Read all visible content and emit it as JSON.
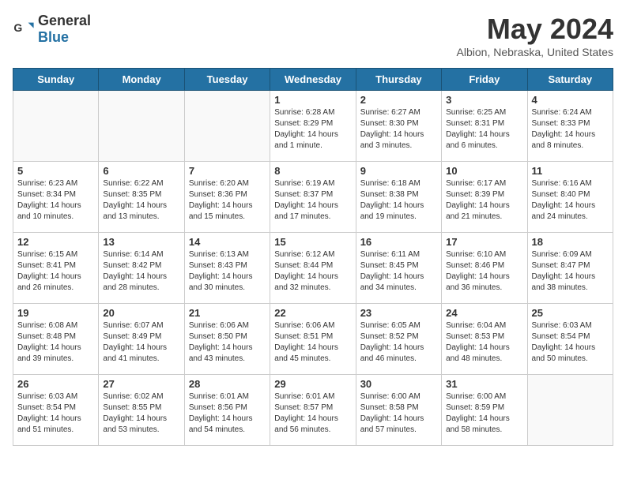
{
  "header": {
    "logo_general": "General",
    "logo_blue": "Blue",
    "month_title": "May 2024",
    "location": "Albion, Nebraska, United States"
  },
  "days_of_week": [
    "Sunday",
    "Monday",
    "Tuesday",
    "Wednesday",
    "Thursday",
    "Friday",
    "Saturday"
  ],
  "weeks": [
    [
      {
        "day": "",
        "info": ""
      },
      {
        "day": "",
        "info": ""
      },
      {
        "day": "",
        "info": ""
      },
      {
        "day": "1",
        "info": "Sunrise: 6:28 AM\nSunset: 8:29 PM\nDaylight: 14 hours\nand 1 minute."
      },
      {
        "day": "2",
        "info": "Sunrise: 6:27 AM\nSunset: 8:30 PM\nDaylight: 14 hours\nand 3 minutes."
      },
      {
        "day": "3",
        "info": "Sunrise: 6:25 AM\nSunset: 8:31 PM\nDaylight: 14 hours\nand 6 minutes."
      },
      {
        "day": "4",
        "info": "Sunrise: 6:24 AM\nSunset: 8:33 PM\nDaylight: 14 hours\nand 8 minutes."
      }
    ],
    [
      {
        "day": "5",
        "info": "Sunrise: 6:23 AM\nSunset: 8:34 PM\nDaylight: 14 hours\nand 10 minutes."
      },
      {
        "day": "6",
        "info": "Sunrise: 6:22 AM\nSunset: 8:35 PM\nDaylight: 14 hours\nand 13 minutes."
      },
      {
        "day": "7",
        "info": "Sunrise: 6:20 AM\nSunset: 8:36 PM\nDaylight: 14 hours\nand 15 minutes."
      },
      {
        "day": "8",
        "info": "Sunrise: 6:19 AM\nSunset: 8:37 PM\nDaylight: 14 hours\nand 17 minutes."
      },
      {
        "day": "9",
        "info": "Sunrise: 6:18 AM\nSunset: 8:38 PM\nDaylight: 14 hours\nand 19 minutes."
      },
      {
        "day": "10",
        "info": "Sunrise: 6:17 AM\nSunset: 8:39 PM\nDaylight: 14 hours\nand 21 minutes."
      },
      {
        "day": "11",
        "info": "Sunrise: 6:16 AM\nSunset: 8:40 PM\nDaylight: 14 hours\nand 24 minutes."
      }
    ],
    [
      {
        "day": "12",
        "info": "Sunrise: 6:15 AM\nSunset: 8:41 PM\nDaylight: 14 hours\nand 26 minutes."
      },
      {
        "day": "13",
        "info": "Sunrise: 6:14 AM\nSunset: 8:42 PM\nDaylight: 14 hours\nand 28 minutes."
      },
      {
        "day": "14",
        "info": "Sunrise: 6:13 AM\nSunset: 8:43 PM\nDaylight: 14 hours\nand 30 minutes."
      },
      {
        "day": "15",
        "info": "Sunrise: 6:12 AM\nSunset: 8:44 PM\nDaylight: 14 hours\nand 32 minutes."
      },
      {
        "day": "16",
        "info": "Sunrise: 6:11 AM\nSunset: 8:45 PM\nDaylight: 14 hours\nand 34 minutes."
      },
      {
        "day": "17",
        "info": "Sunrise: 6:10 AM\nSunset: 8:46 PM\nDaylight: 14 hours\nand 36 minutes."
      },
      {
        "day": "18",
        "info": "Sunrise: 6:09 AM\nSunset: 8:47 PM\nDaylight: 14 hours\nand 38 minutes."
      }
    ],
    [
      {
        "day": "19",
        "info": "Sunrise: 6:08 AM\nSunset: 8:48 PM\nDaylight: 14 hours\nand 39 minutes."
      },
      {
        "day": "20",
        "info": "Sunrise: 6:07 AM\nSunset: 8:49 PM\nDaylight: 14 hours\nand 41 minutes."
      },
      {
        "day": "21",
        "info": "Sunrise: 6:06 AM\nSunset: 8:50 PM\nDaylight: 14 hours\nand 43 minutes."
      },
      {
        "day": "22",
        "info": "Sunrise: 6:06 AM\nSunset: 8:51 PM\nDaylight: 14 hours\nand 45 minutes."
      },
      {
        "day": "23",
        "info": "Sunrise: 6:05 AM\nSunset: 8:52 PM\nDaylight: 14 hours\nand 46 minutes."
      },
      {
        "day": "24",
        "info": "Sunrise: 6:04 AM\nSunset: 8:53 PM\nDaylight: 14 hours\nand 48 minutes."
      },
      {
        "day": "25",
        "info": "Sunrise: 6:03 AM\nSunset: 8:54 PM\nDaylight: 14 hours\nand 50 minutes."
      }
    ],
    [
      {
        "day": "26",
        "info": "Sunrise: 6:03 AM\nSunset: 8:54 PM\nDaylight: 14 hours\nand 51 minutes."
      },
      {
        "day": "27",
        "info": "Sunrise: 6:02 AM\nSunset: 8:55 PM\nDaylight: 14 hours\nand 53 minutes."
      },
      {
        "day": "28",
        "info": "Sunrise: 6:01 AM\nSunset: 8:56 PM\nDaylight: 14 hours\nand 54 minutes."
      },
      {
        "day": "29",
        "info": "Sunrise: 6:01 AM\nSunset: 8:57 PM\nDaylight: 14 hours\nand 56 minutes."
      },
      {
        "day": "30",
        "info": "Sunrise: 6:00 AM\nSunset: 8:58 PM\nDaylight: 14 hours\nand 57 minutes."
      },
      {
        "day": "31",
        "info": "Sunrise: 6:00 AM\nSunset: 8:59 PM\nDaylight: 14 hours\nand 58 minutes."
      },
      {
        "day": "",
        "info": ""
      }
    ]
  ]
}
